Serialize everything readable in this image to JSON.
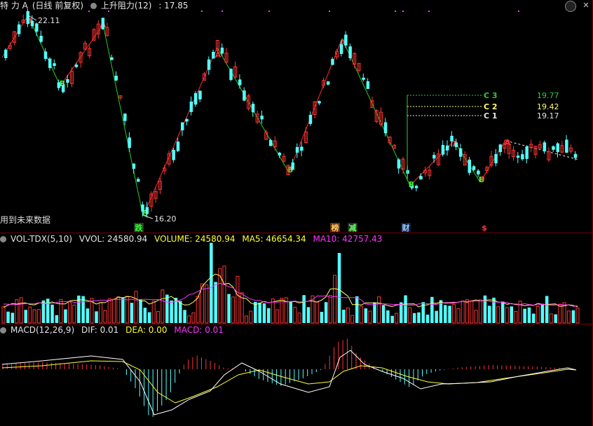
{
  "price_panel": {
    "stock_name": "特 力 A",
    "period": "(日线 前复权)",
    "indicator": "上升阻力(12)",
    "indicator_value": ": 17.85",
    "no_future_data": "用到未来数据",
    "high_label": "22.11",
    "low_label": "16.20",
    "c_lines": [
      {
        "name": "C 3",
        "value": "19.77",
        "color": "#33cc33"
      },
      {
        "name": "C 2",
        "value": "19.42",
        "color": "#ffff66"
      },
      {
        "name": "C 1",
        "value": "19.17",
        "color": "#e6e6e6"
      }
    ],
    "wave_points": [
      {
        "label": "B",
        "color": "#33ff33"
      },
      {
        "label": "A",
        "color": "#ff3333"
      },
      {
        "label": "B",
        "color": "#33ff33"
      },
      {
        "label": "A",
        "color": "#ff3333"
      },
      {
        "label": "B",
        "color": "#33ff33"
      },
      {
        "label": "A",
        "color": "#ff3333"
      },
      {
        "label": "B",
        "color": "#33ff33"
      },
      {
        "label": "A",
        "color": "#ff3333"
      },
      {
        "label": "B",
        "color": "#33ff33"
      },
      {
        "label": "A",
        "color": "#ff3333"
      },
      {
        "label": "B",
        "color": "#33ff33"
      },
      {
        "label": "A",
        "color": "#ff3333"
      }
    ],
    "event_markers": [
      {
        "text": "跌",
        "color": "#33ff33",
        "bg": "#204020"
      },
      {
        "text": "榜",
        "color": "#ffcc66",
        "bg": "#603010"
      },
      {
        "text": "减",
        "color": "#66ff66",
        "bg": "#203020"
      },
      {
        "text": "财",
        "color": "#99ccff",
        "bg": "#102040"
      },
      {
        "text": "$",
        "color": "#ff3333",
        "bg": "#000000"
      }
    ]
  },
  "volume_panel": {
    "name": "VOL-TDX(5,10)",
    "vvol": "VVOL: 24580.94",
    "volume": "VOLUME: 24580.94",
    "ma5": "MA5: 46654.34",
    "ma10": "MA10: 42757.43"
  },
  "macd_panel": {
    "name": "MACD(12,26,9)",
    "dif": "DIF: 0.01",
    "dea": "DEA: 0.00",
    "macd": "MACD: 0.01"
  },
  "colors": {
    "up": "#ff3333",
    "down": "#54ffff",
    "background": "#000000",
    "separator": "#7a0000",
    "ma5": "#ffff66",
    "ma10": "#ff33ff",
    "dif": "#ffffff",
    "dea": "#ffff33"
  }
}
